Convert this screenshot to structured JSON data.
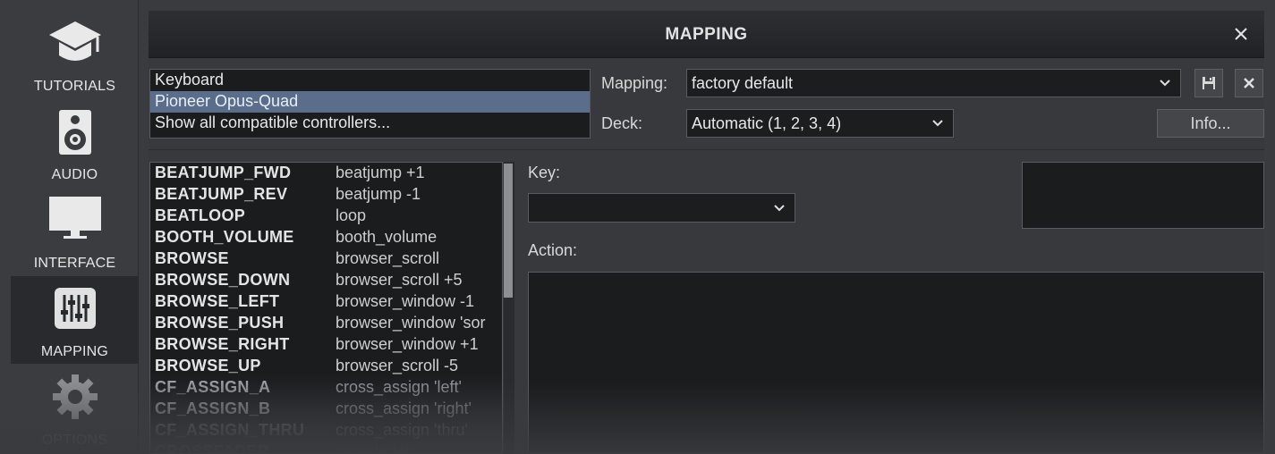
{
  "sidebar": {
    "items": [
      {
        "label": "TUTORIALS",
        "icon": "graduation-cap-icon"
      },
      {
        "label": "AUDIO",
        "icon": "speaker-icon"
      },
      {
        "label": "INTERFACE",
        "icon": "monitor-icon"
      },
      {
        "label": "MAPPING",
        "icon": "sliders-icon",
        "active": true
      },
      {
        "label": "OPTIONS",
        "icon": "gear-icon"
      }
    ]
  },
  "panel": {
    "title": "MAPPING",
    "close_icon": "close-icon"
  },
  "controllers": {
    "items": [
      "Keyboard",
      "Pioneer Opus-Quad",
      "Show all compatible controllers..."
    ],
    "selected": "Pioneer Opus-Quad"
  },
  "mapping": {
    "label": "Mapping:",
    "value": "factory default",
    "save_icon": "save-icon",
    "delete_icon": "delete-icon"
  },
  "deck": {
    "label": "Deck:",
    "value": "Automatic (1, 2, 3, 4)"
  },
  "info_button": "Info...",
  "key": {
    "label": "Key:",
    "value": ""
  },
  "action": {
    "label": "Action:",
    "value": ""
  },
  "actions": [
    {
      "name": "BEATJUMP_FWD",
      "value": "beatjump +1"
    },
    {
      "name": "BEATJUMP_REV",
      "value": "beatjump -1"
    },
    {
      "name": "BEATLOOP",
      "value": "loop"
    },
    {
      "name": "BOOTH_VOLUME",
      "value": "booth_volume"
    },
    {
      "name": "BROWSE",
      "value": "browser_scroll"
    },
    {
      "name": "BROWSE_DOWN",
      "value": "browser_scroll +5"
    },
    {
      "name": "BROWSE_LEFT",
      "value": "browser_window -1"
    },
    {
      "name": "BROWSE_PUSH",
      "value": "browser_window 'sor"
    },
    {
      "name": "BROWSE_RIGHT",
      "value": "browser_window +1"
    },
    {
      "name": "BROWSE_UP",
      "value": "browser_scroll -5"
    },
    {
      "name": "CF_ASSIGN_A",
      "value": "cross_assign 'left'"
    },
    {
      "name": "CF_ASSIGN_B",
      "value": "cross_assign 'right'"
    },
    {
      "name": "CF_ASSIGN_THRU",
      "value": "cross_assign 'thru'"
    },
    {
      "name": "CROSSFADER",
      "value": "crossfader"
    }
  ],
  "colors": {
    "selection": "#5a6d8a",
    "background": "#3a3b3e",
    "field": "#1b1c1e"
  }
}
